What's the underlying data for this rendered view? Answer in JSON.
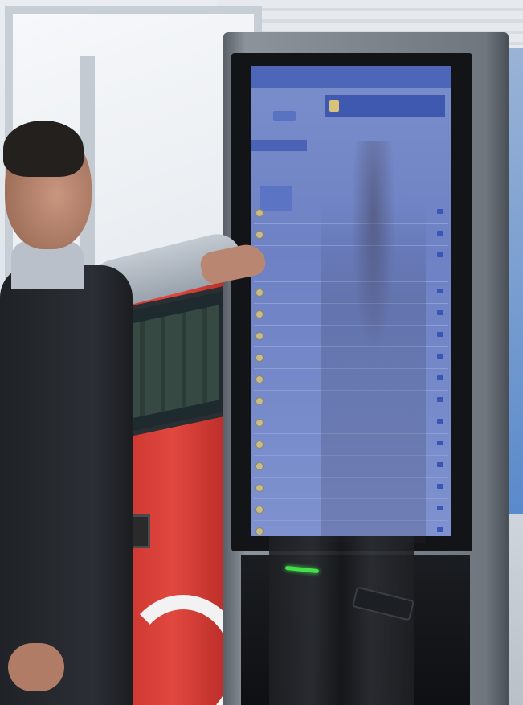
{
  "scene": {
    "description_free": true
  },
  "kiosk_screen": {
    "header_title": "",
    "banner_text": ""
  },
  "signage_rows": [
    {
      "text": ""
    },
    {
      "text": ""
    },
    {
      "text": ""
    },
    {
      "text": ""
    },
    {
      "text": ""
    },
    {
      "text": ""
    },
    {
      "text": ""
    },
    {
      "text": ""
    },
    {
      "text": ""
    },
    {
      "text": ""
    },
    {
      "text": ""
    },
    {
      "text": ""
    },
    {
      "text": ""
    },
    {
      "text": ""
    },
    {
      "text": ""
    }
  ],
  "colors": {
    "screen_blue": "#6d81c4",
    "kiosk_red": "#e0483f",
    "led_green": "#44e04a"
  }
}
